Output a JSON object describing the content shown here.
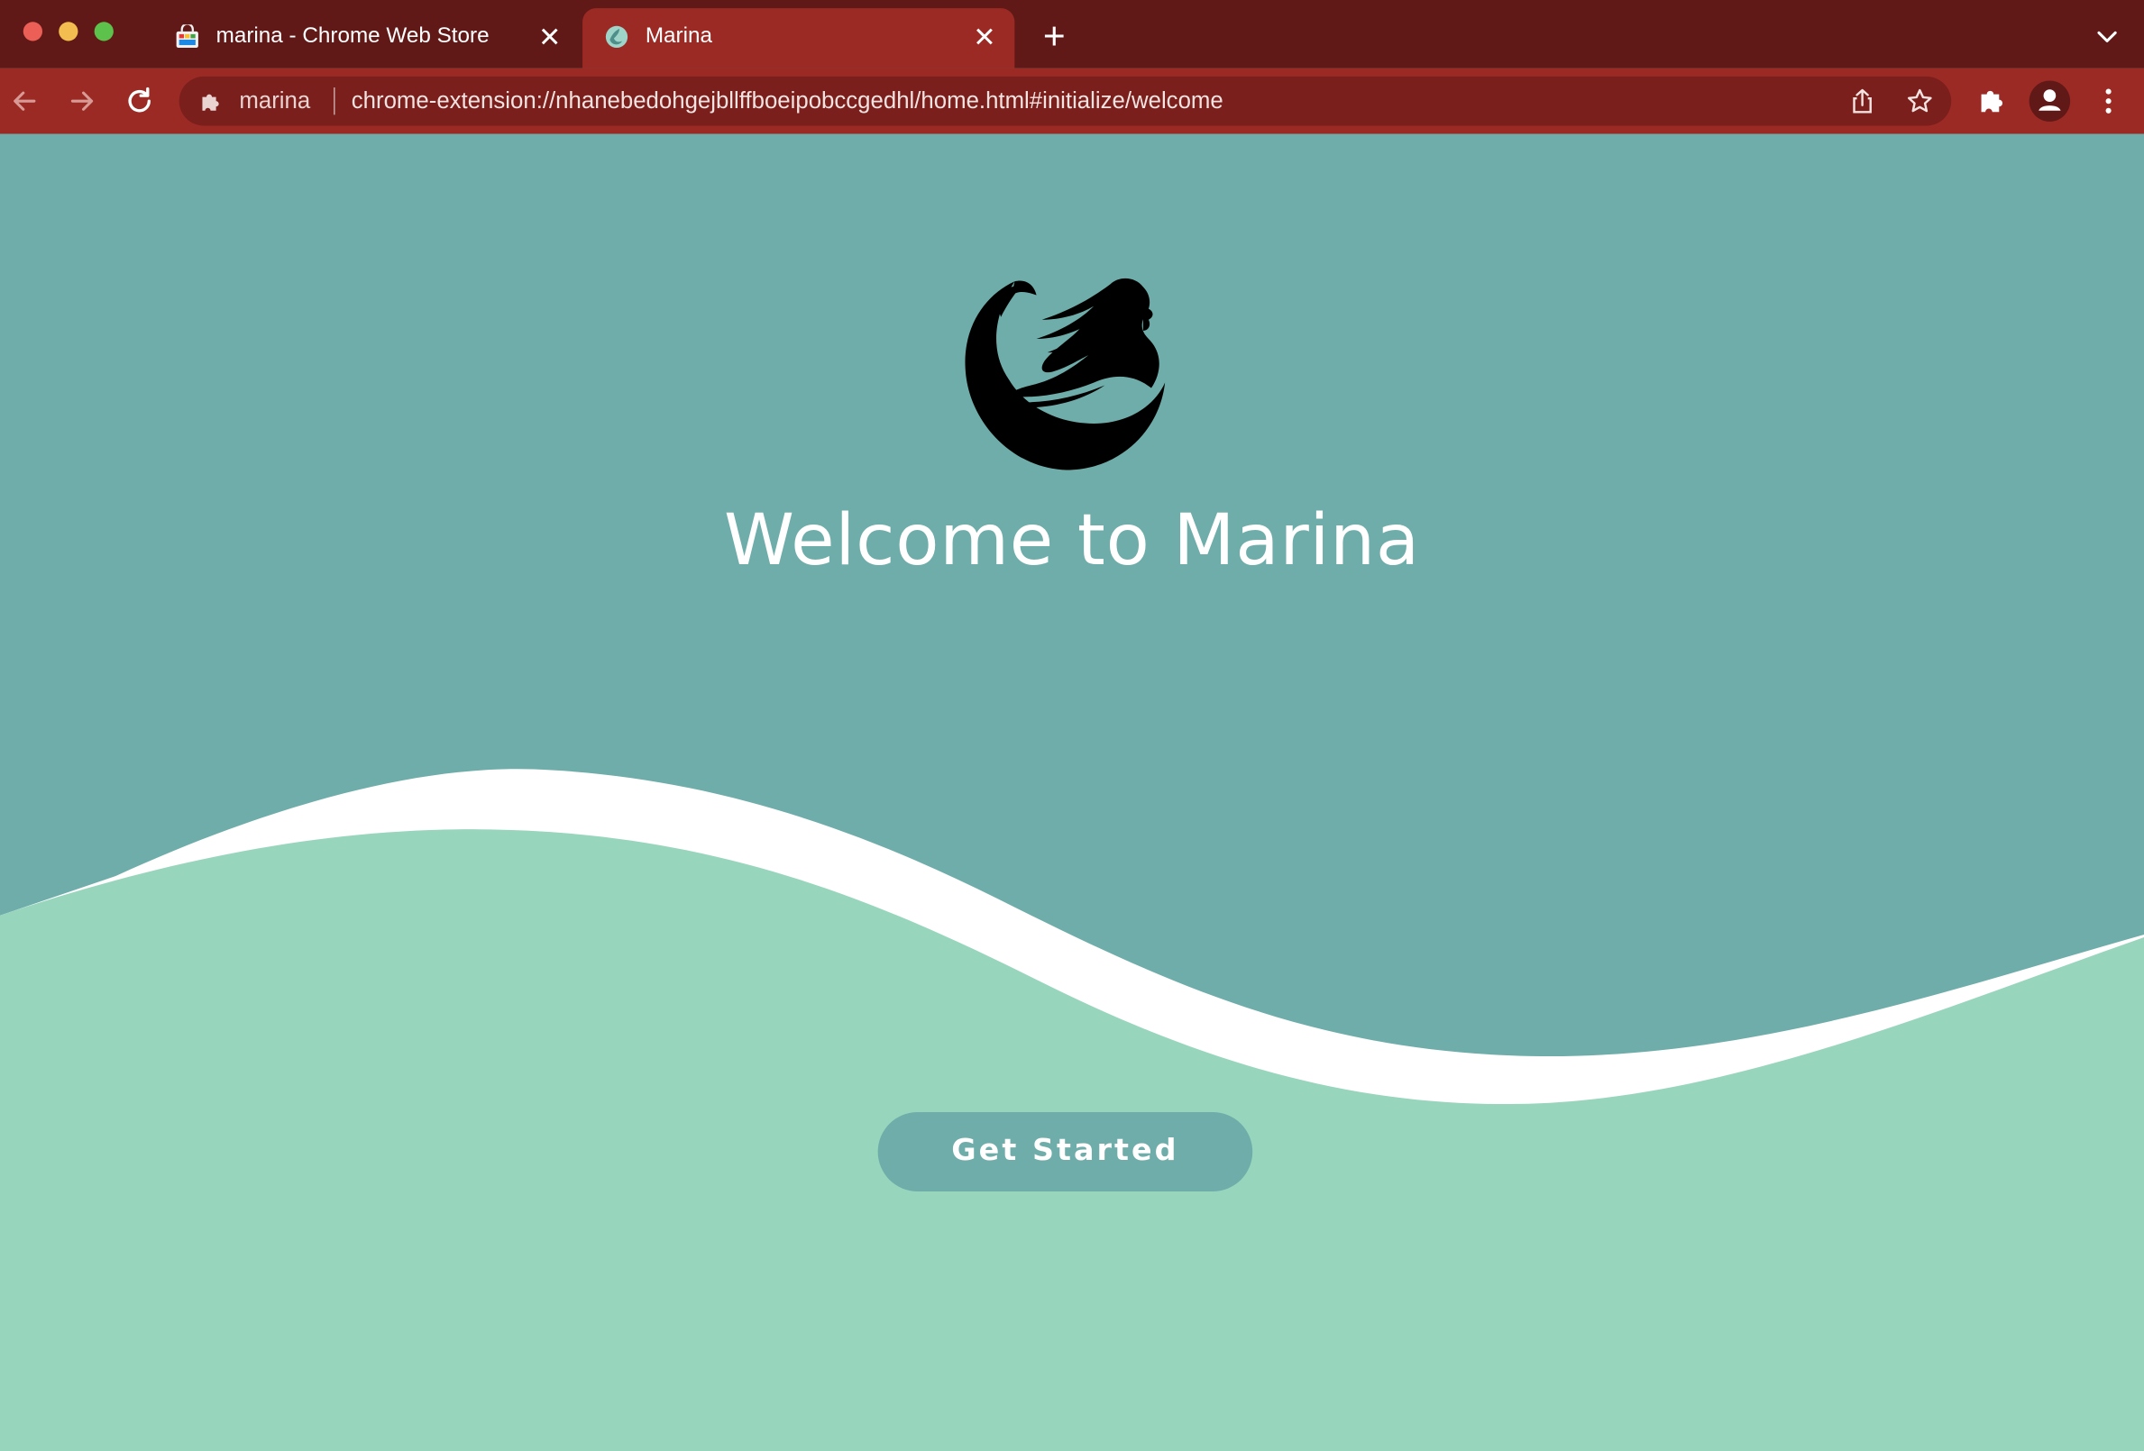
{
  "browser": {
    "tabs": [
      {
        "title": "marina - Chrome Web Store",
        "favicon": "chrome-web-store-icon",
        "active": false
      },
      {
        "title": "Marina",
        "favicon": "mermaid-icon",
        "active": true
      }
    ],
    "new_tab_symbol": "+",
    "close_symbol": "✕",
    "omnibox": {
      "chip_label": "marina",
      "url": "chrome-extension://nhanebedohgejbllffboeipobccgedhl/home.html#initialize/welcome"
    },
    "colors": {
      "tabstrip": "#611918",
      "toolbar": "#9c2a24"
    }
  },
  "page": {
    "heading": "Welcome to Marina",
    "cta_label": "Get Started",
    "logo": "mermaid-logo-icon",
    "colors": {
      "background": "#6eada9",
      "wave_light": "#98d5bd",
      "wave_highlight": "#ffffff",
      "button_bg": "#6eada9",
      "button_text": "#ffffff"
    }
  }
}
